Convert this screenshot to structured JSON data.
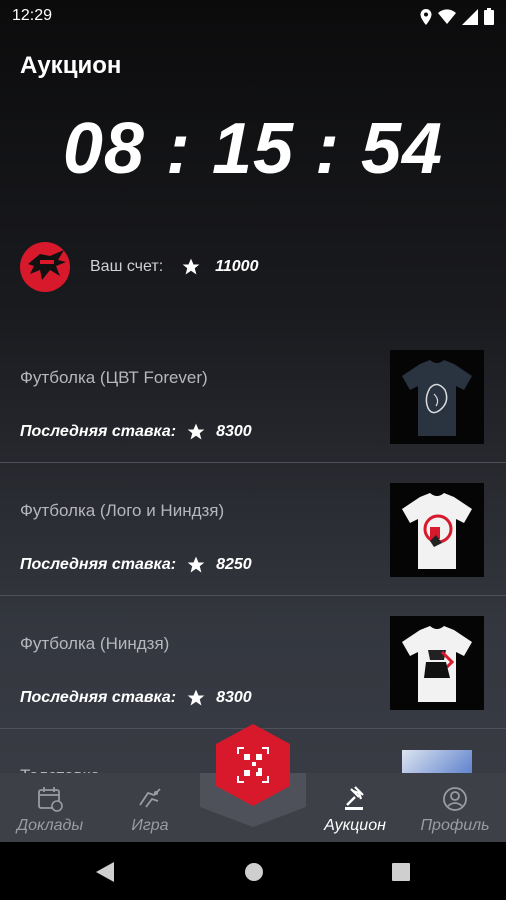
{
  "status": {
    "time": "12:29"
  },
  "header": {
    "title": "Аукцион"
  },
  "timer": {
    "value": "08 : 15 : 54"
  },
  "score": {
    "label": "Ваш счет:",
    "value": "11000"
  },
  "items": [
    {
      "name": "Футболка (ЦВТ Forever)",
      "bid_label": "Последняя ставка:",
      "bid_value": "8300"
    },
    {
      "name": "Футболка (Лого и Ниндзя)",
      "bid_label": "Последняя ставка:",
      "bid_value": "8250"
    },
    {
      "name": "Футболка (Ниндзя)",
      "bid_label": "Последняя ставка:",
      "bid_value": "8300"
    }
  ],
  "partial_item": {
    "name": "Толстовка"
  },
  "nav": {
    "items": [
      {
        "label": "Доклады",
        "icon": "calendar-icon"
      },
      {
        "label": "Игра",
        "icon": "game-icon"
      },
      {
        "label": "Аукцион",
        "icon": "gavel-icon",
        "active": true
      },
      {
        "label": "Профиль",
        "icon": "profile-icon"
      }
    ],
    "fab_icon": "qr-scan-icon"
  },
  "colors": {
    "accent": "#d7192b",
    "nav_bg": "#3d4047",
    "divider": "#4e5159"
  }
}
